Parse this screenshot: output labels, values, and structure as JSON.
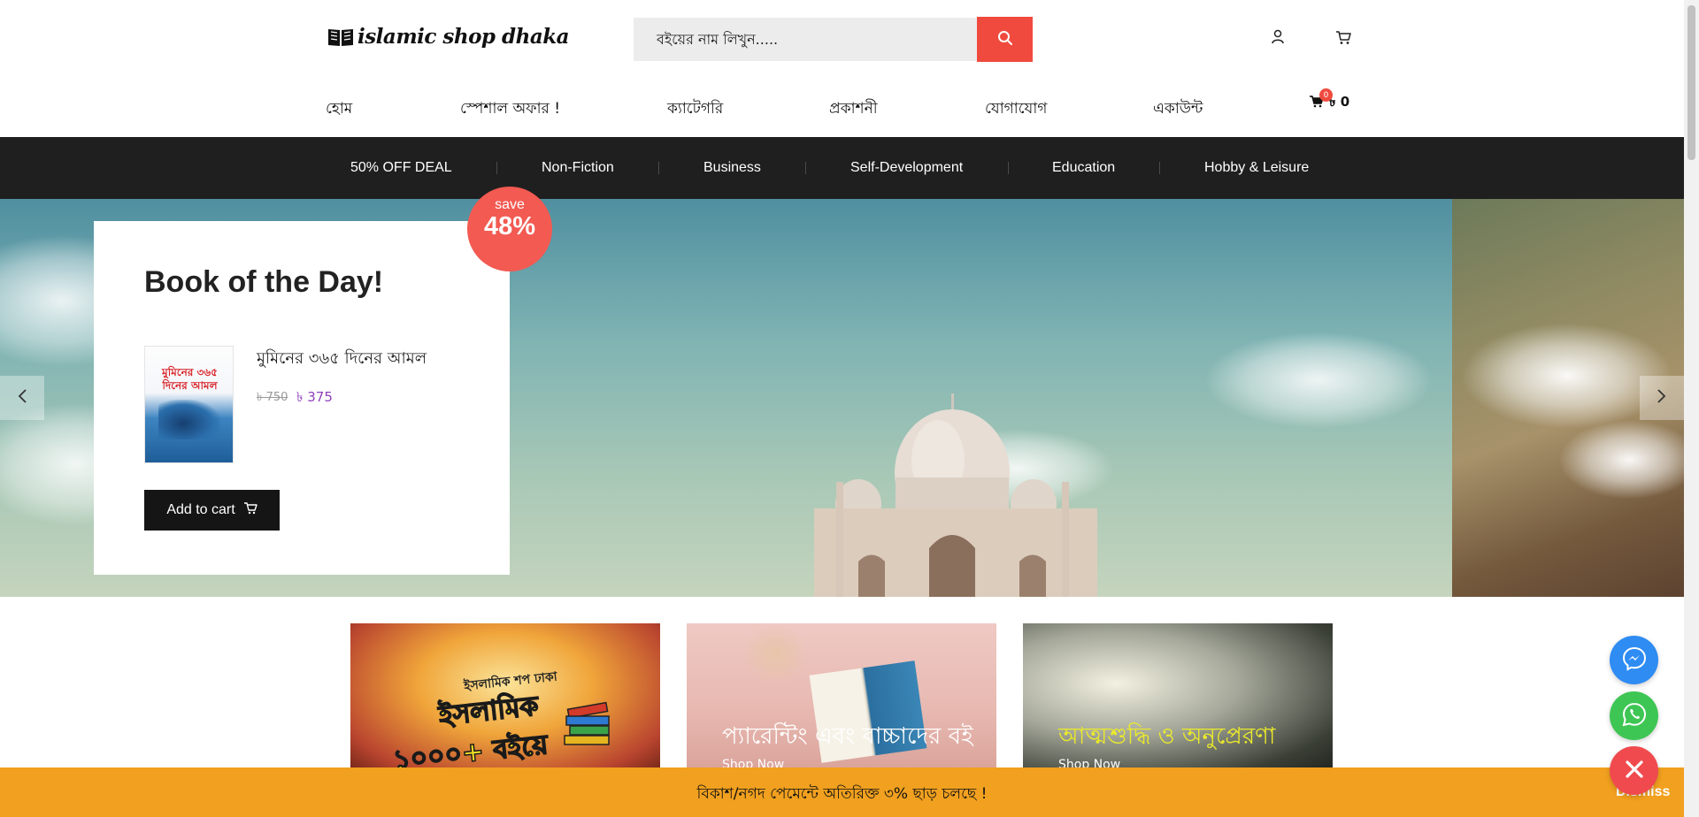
{
  "header": {
    "logo_text": "islamic shop dhaka",
    "search_placeholder": "বইয়ের নাম লিখুন.....",
    "icons": [
      "user-icon",
      "cart-icon",
      "search-icon"
    ]
  },
  "mainnav": {
    "items": [
      "হোম",
      "স্পেশাল অফার !",
      "ক্যাটেগরি",
      "প্রকাশনী",
      "যোগাযোগ",
      "একাউন্ট"
    ],
    "cart_count": "0",
    "cart_total": "৳ 0"
  },
  "categories": [
    "50% OFF DEAL",
    "Non-Fiction",
    "Business",
    "Self-Development",
    "Education",
    "Hobby & Leisure"
  ],
  "deal": {
    "title": "Book of the Day!",
    "save_label": "save",
    "save_percent": "48%",
    "book_name": "মুমিনের ৩৬৫ দিনের আমল",
    "cover_title": "মুমিনের ৩৬৫ দিনের আমল",
    "old_price": "৳ 750",
    "new_price": "৳ 375",
    "add_to_cart": "Add to cart"
  },
  "banners": [
    {
      "small": "ইসলামিক শপ ঢাকা",
      "line1": "ইসলামিক",
      "line2": "১০০০+ বইয়ে",
      "title": "",
      "link": ""
    },
    {
      "title": "প্যারেন্টিং এবং বাচ্চাদের বই",
      "link": "Shop Now"
    },
    {
      "title": "আত্মশুদ্ধি ও অনুপ্রেরণা",
      "link": "Shop Now"
    }
  ],
  "notice": {
    "text": "বিকাশ/নগদ পেমেন্টে অতিরিক্ত ৩% ছাড় চলছে !",
    "dismiss": "Dismiss"
  },
  "colors": {
    "accent": "#f04a3e",
    "catbar": "#1f1f1f",
    "notice": "#f1a01f",
    "price": "#8e3fbc"
  }
}
